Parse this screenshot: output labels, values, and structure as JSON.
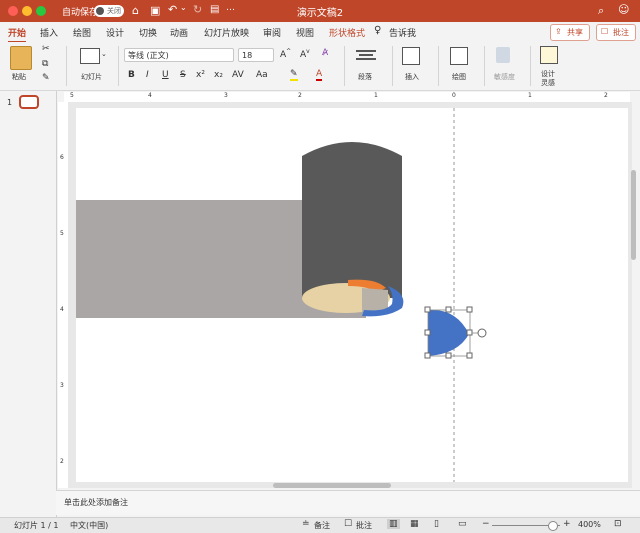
{
  "titlebar": {
    "autosave_label": "自动保存",
    "toggle_state": "关闭",
    "title": "演示文稿2",
    "dot_colors": [
      "#ff5f57",
      "#febc2e",
      "#28c840"
    ]
  },
  "tabs": [
    "开始",
    "插入",
    "绘图",
    "设计",
    "切换",
    "动画",
    "幻灯片放映",
    "审阅",
    "视图",
    "形状格式"
  ],
  "active_tab": "开始",
  "tell_me": "告诉我",
  "share_label": "共享",
  "comment_label": "批注",
  "ribbon": {
    "paste": "粘贴",
    "slide": "幻灯片",
    "font_name": "等线 (正文)",
    "font_size": "18",
    "paragraph": "段落",
    "insert": "插入",
    "drawing": "绘图",
    "sensitivity": "敏感度",
    "designer_line1": "设计",
    "designer_line2": "灵感",
    "format_buttons": [
      "B",
      "I",
      "U",
      "S",
      "x²",
      "x₂",
      "AV",
      "Aa",
      "A"
    ]
  },
  "slide_number": "1",
  "ruler": {
    "h_ticks": [
      "5",
      "4",
      "3",
      "2",
      "1",
      "0",
      "1",
      "2"
    ],
    "v_ticks": [
      "6",
      "5",
      "4",
      "3",
      "2"
    ]
  },
  "notes_placeholder": "单击此处添加备注",
  "status": {
    "slide_counter": "幻灯片 1 / 1",
    "language": "中文(中国)",
    "notes": "备注",
    "comments": "批注",
    "zoom": "400%"
  },
  "colors": {
    "accent": "#c0462a",
    "gray_block": "#aaa6a5",
    "cylinder": "#595959",
    "beige": "#e7d2a5",
    "orange": "#ed7d31",
    "blue": "#4472c4"
  }
}
